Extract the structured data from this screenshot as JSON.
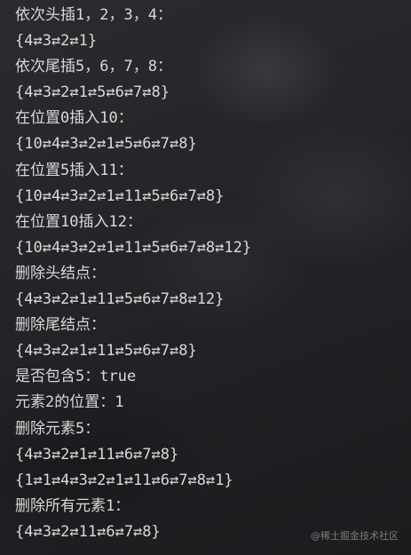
{
  "console": {
    "lines": [
      "依次头插1，2，3，4：",
      "{4⇄3⇄2⇄1}",
      "依次尾插5，6，7，8：",
      "{4⇄3⇄2⇄1⇄5⇄6⇄7⇄8}",
      "在位置0插入10：",
      "{10⇄4⇄3⇄2⇄1⇄5⇄6⇄7⇄8}",
      "在位置5插入11：",
      "{10⇄4⇄3⇄2⇄1⇄11⇄5⇄6⇄7⇄8}",
      "在位置10插入12：",
      "{10⇄4⇄3⇄2⇄1⇄11⇄5⇄6⇄7⇄8⇄12}",
      "删除头结点：",
      "{4⇄3⇄2⇄1⇄11⇄5⇄6⇄7⇄8⇄12}",
      "删除尾结点：",
      "{4⇄3⇄2⇄1⇄11⇄5⇄6⇄7⇄8}",
      "是否包含5：true",
      "元素2的位置：1",
      "删除元素5：",
      "{4⇄3⇄2⇄1⇄11⇄6⇄7⇄8}",
      "{1⇄1⇄4⇄3⇄2⇄1⇄11⇄6⇄7⇄8⇄1}",
      "删除所有元素1：",
      "{4⇄3⇄2⇄11⇄6⇄7⇄8}"
    ]
  },
  "watermark": "@稀土掘金技术社区"
}
